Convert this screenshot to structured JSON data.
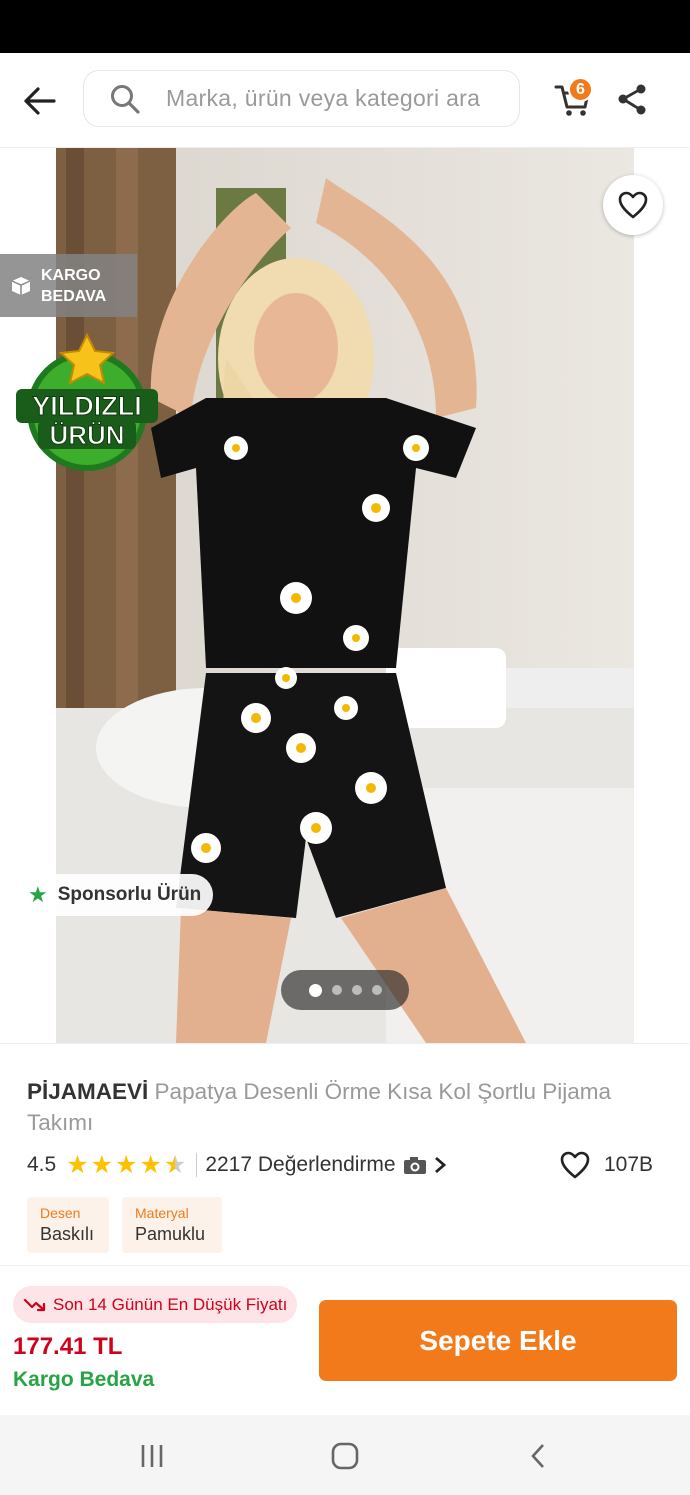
{
  "header": {
    "search_placeholder": "Marka, ürün veya kategori ara",
    "cart_count": "6"
  },
  "gallery": {
    "kargo_line1": "KARGO",
    "kargo_line2": "BEDAVA",
    "yildizli_line1": "YILDIZLI",
    "yildizli_line2": "ÜRÜN",
    "sponsor_label": "Sponsorlu Ürün",
    "image_count": 4,
    "active_image": 1
  },
  "product": {
    "brand": "PİJAMAEVİ",
    "name": "Papatya Desenli Örme Kısa Kol Şortlu Pijama Takımı",
    "rating": "4.5",
    "review_count": "2217 Değerlendirme",
    "favorites": "107B",
    "attributes": [
      {
        "key": "Desen",
        "value": "Baskılı"
      },
      {
        "key": "Materyal",
        "value": "Pamuklu"
      }
    ]
  },
  "purchase": {
    "lowest_price_badge": "Son 14 Günün En Düşük Fiyatı",
    "price": "177.41 TL",
    "shipping": "Kargo Bedava",
    "add_to_cart_label": "Sepete Ekle"
  },
  "colors": {
    "accent": "#f27a1a",
    "price_red": "#d0021b",
    "green": "#27a444",
    "star": "#ffc000"
  }
}
